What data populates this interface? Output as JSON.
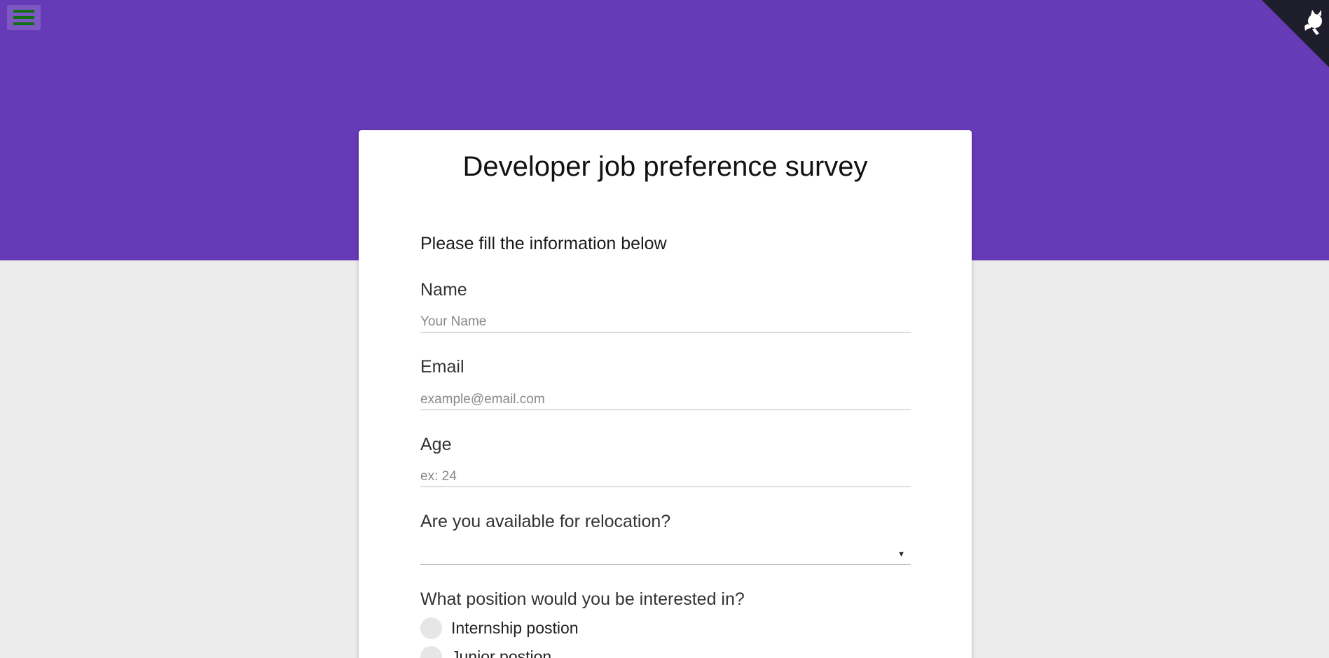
{
  "header": {
    "menu_icon": "hamburger-menu-icon",
    "corner_icon": "github-octocat-corner-icon",
    "banner_color": "#673ab7",
    "menu_bar_color": "#0f6f12"
  },
  "survey": {
    "title": "Developer job preference survey",
    "intro": "Please fill the information below",
    "name": {
      "label": "Name",
      "placeholder": "Your Name",
      "value": ""
    },
    "email": {
      "label": "Email",
      "placeholder": "example@email.com",
      "value": ""
    },
    "age": {
      "label": "Age",
      "placeholder": "ex: 24",
      "value": ""
    },
    "relocation": {
      "label": "Are you available for relocation?",
      "selected": ""
    },
    "position": {
      "label": "What position would you be interested in?",
      "options": [
        "Internship postion",
        "Junior postion"
      ]
    }
  }
}
